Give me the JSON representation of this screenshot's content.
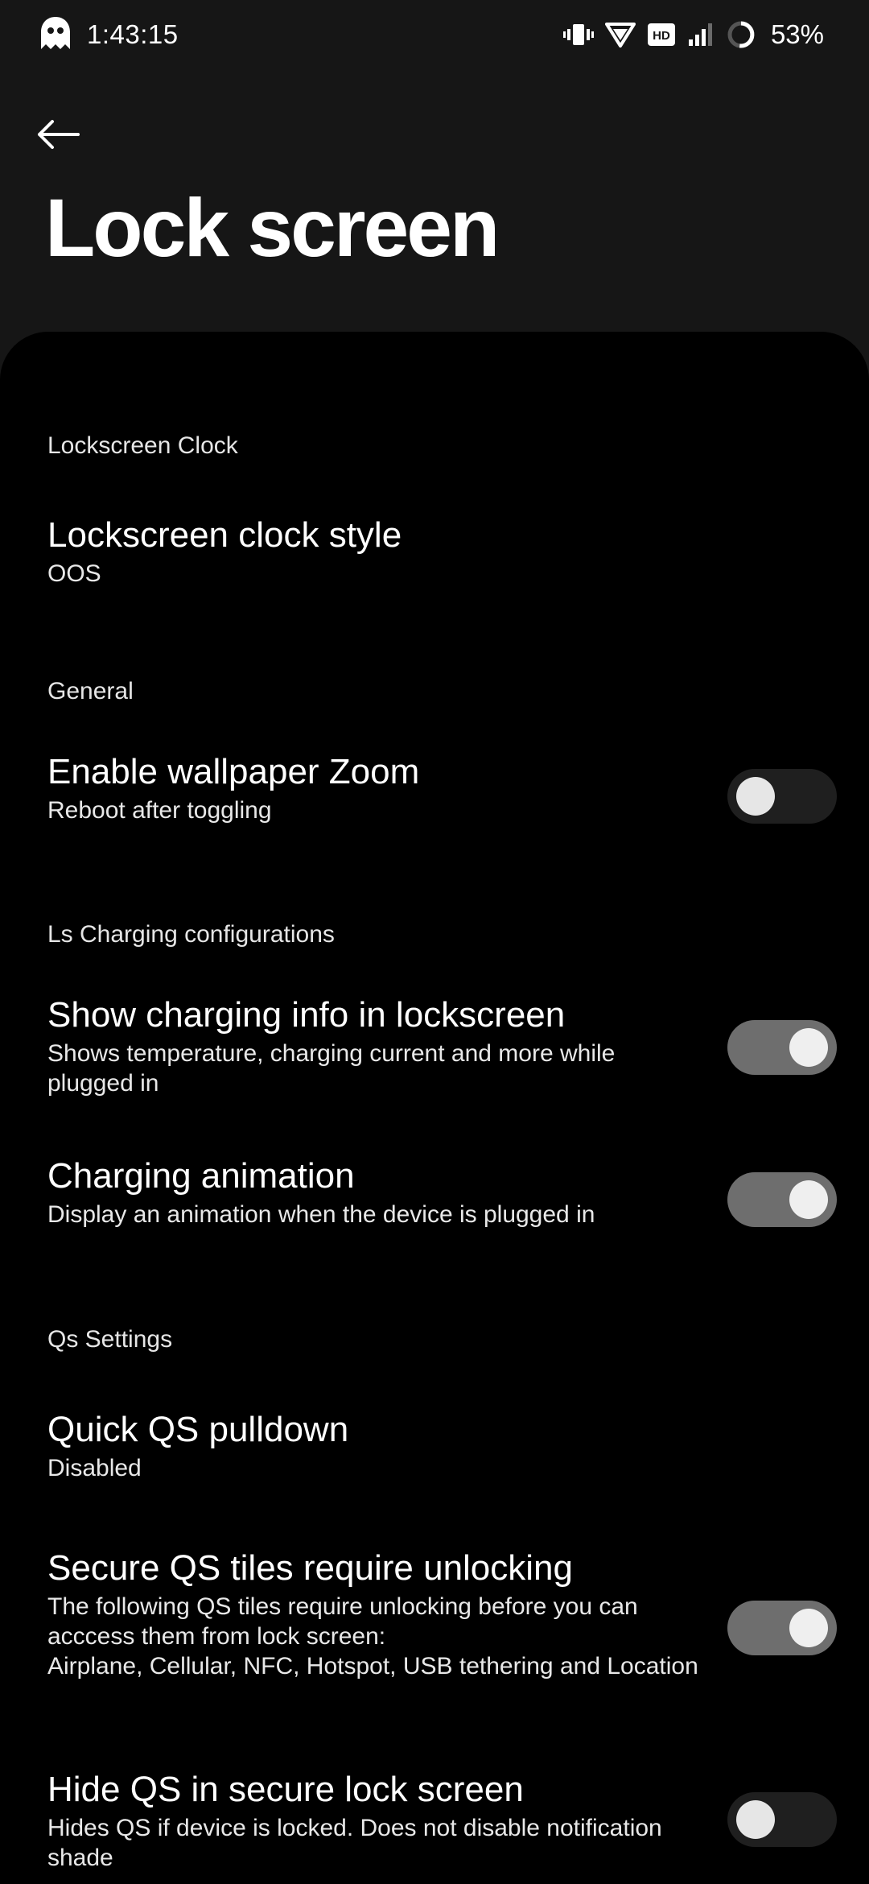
{
  "status_bar": {
    "time": "1:43:15",
    "battery": "53%",
    "icons": [
      "ghost-icon",
      "vibrate-icon",
      "wifi-icon",
      "hd-icon",
      "signal-icon",
      "battery-ring-icon"
    ]
  },
  "header": {
    "back_icon": "arrow-left-icon",
    "title": "Lock screen"
  },
  "sections": [
    {
      "header": "Lockscreen Clock",
      "items": [
        {
          "title": "Lockscreen clock style",
          "summary": "OOS"
        }
      ]
    },
    {
      "header": "General",
      "items": [
        {
          "title": "Enable wallpaper Zoom",
          "summary": "Reboot after toggling",
          "toggle": false
        }
      ]
    },
    {
      "header": "Ls Charging configurations",
      "items": [
        {
          "title": "Show charging info in lockscreen",
          "summary": "Shows temperature, charging current and more while plugged in",
          "toggle": true
        },
        {
          "title": "Charging animation",
          "summary": "Display an animation when the device is plugged in",
          "toggle": true
        }
      ]
    },
    {
      "header": "Qs Settings",
      "items": [
        {
          "title": "Quick QS pulldown",
          "summary": "Disabled"
        },
        {
          "title": "Secure QS tiles require unlocking",
          "summary_lines": [
            "The following QS tiles require unlocking before you can acccess them from lock screen:",
            "Airplane, Cellular, NFC, Hotspot, USB tethering and Location"
          ],
          "toggle": true
        },
        {
          "title": "Hide QS in secure lock screen",
          "summary": "Hides QS if device is locked. Does not disable notification shade",
          "toggle": false
        }
      ]
    }
  ],
  "colors": {
    "header_bg": "#161616",
    "sheet_bg": "#000000",
    "toggle_on_track": "#6e6e6e",
    "toggle_off_track": "#1f1f1f",
    "thumb": "#e6e6e6"
  }
}
